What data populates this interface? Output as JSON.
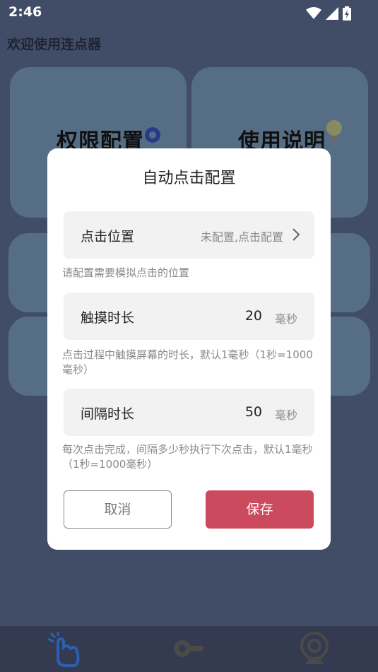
{
  "status_bar": {
    "time": "2:46"
  },
  "app": {
    "title": "欢迎使用连点器"
  },
  "background_cards": {
    "permission_label": "权限配置",
    "usage_label": "使用说明"
  },
  "dialog": {
    "title": "自动点击配置",
    "click_position": {
      "label": "点击位置",
      "value": "未配置,点击配置",
      "hint": "请配置需要模拟点击的位置"
    },
    "touch_duration": {
      "label": "触摸时长",
      "value": "20",
      "unit": "毫秒",
      "hint": "点击过程中触摸屏幕的时长，默认1毫秒（1秒=1000毫秒）"
    },
    "interval_duration": {
      "label": "间隔时长",
      "value": "50",
      "unit": "毫秒",
      "hint": "每次点击完成，间隔多少秒执行下次点击，默认1毫秒（1秒=1000毫秒）"
    },
    "cancel_label": "取消",
    "save_label": "保存"
  },
  "colors": {
    "overlay_background": "#414d66",
    "save_button": "#cc4a5e"
  },
  "icons": {
    "nav": [
      "tap-hand-icon",
      "key-icon",
      "webcam-icon"
    ]
  }
}
